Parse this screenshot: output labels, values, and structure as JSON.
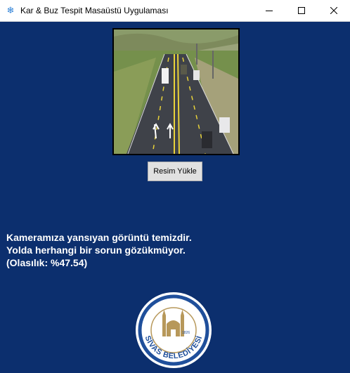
{
  "window": {
    "title": "Kar & Buz Tespit Masaüstü Uygulaması",
    "app_icon": "snowflake-icon"
  },
  "main": {
    "upload_button_label": "Resim Yükle",
    "result_lines": [
      "Kameramıza yansıyan görüntü temizdir.",
      "Yolda herhangi bir sorun gözükmüyor.",
      "(Olasılık: %47.54)"
    ],
    "probability_percent": 47.54
  },
  "logo": {
    "text": "SİVAS BELEDİYESİ",
    "year": "1826"
  },
  "colors": {
    "background": "#0c2f6e",
    "text": "#ffffff",
    "logo_ring": "#1f4f9b",
    "logo_gold": "#b7985a"
  }
}
